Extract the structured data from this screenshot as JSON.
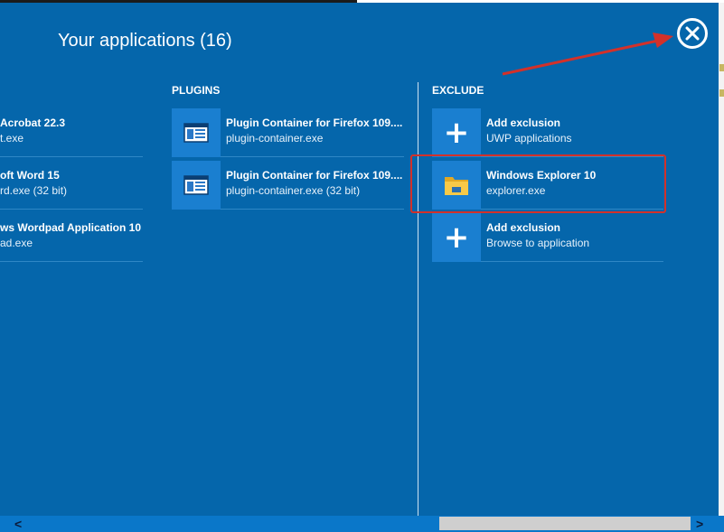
{
  "title": "Your applications (16)",
  "colors": {
    "panel": "#0566ab",
    "tile": "#1a7fd0",
    "highlight": "#d3312a"
  },
  "left_column": {
    "items": [
      {
        "name": "Acrobat 22.3",
        "sub": "t.exe"
      },
      {
        "name": "oft Word 15",
        "sub": "rd.exe (32 bit)"
      },
      {
        "name": "ws Wordpad Application 10",
        "sub": "ad.exe"
      }
    ]
  },
  "plugins": {
    "heading": "PLUGINS",
    "items": [
      {
        "icon": "plugin-window-icon",
        "name": "Plugin Container for Firefox 109....",
        "sub": "plugin-container.exe"
      },
      {
        "icon": "plugin-window-icon",
        "name": "Plugin Container for Firefox 109....",
        "sub": "plugin-container.exe (32 bit)"
      }
    ]
  },
  "exclude": {
    "heading": "EXCLUDE",
    "items": [
      {
        "icon": "plus-icon",
        "name": "Add exclusion",
        "sub": "UWP applications"
      },
      {
        "icon": "folder-icon",
        "name": "Windows Explorer 10",
        "sub": "explorer.exe"
      },
      {
        "icon": "plus-icon",
        "name": "Add exclusion",
        "sub": "Browse to application"
      }
    ]
  },
  "scrollbar": {
    "left_arrow": "<",
    "right_arrow": ">"
  }
}
